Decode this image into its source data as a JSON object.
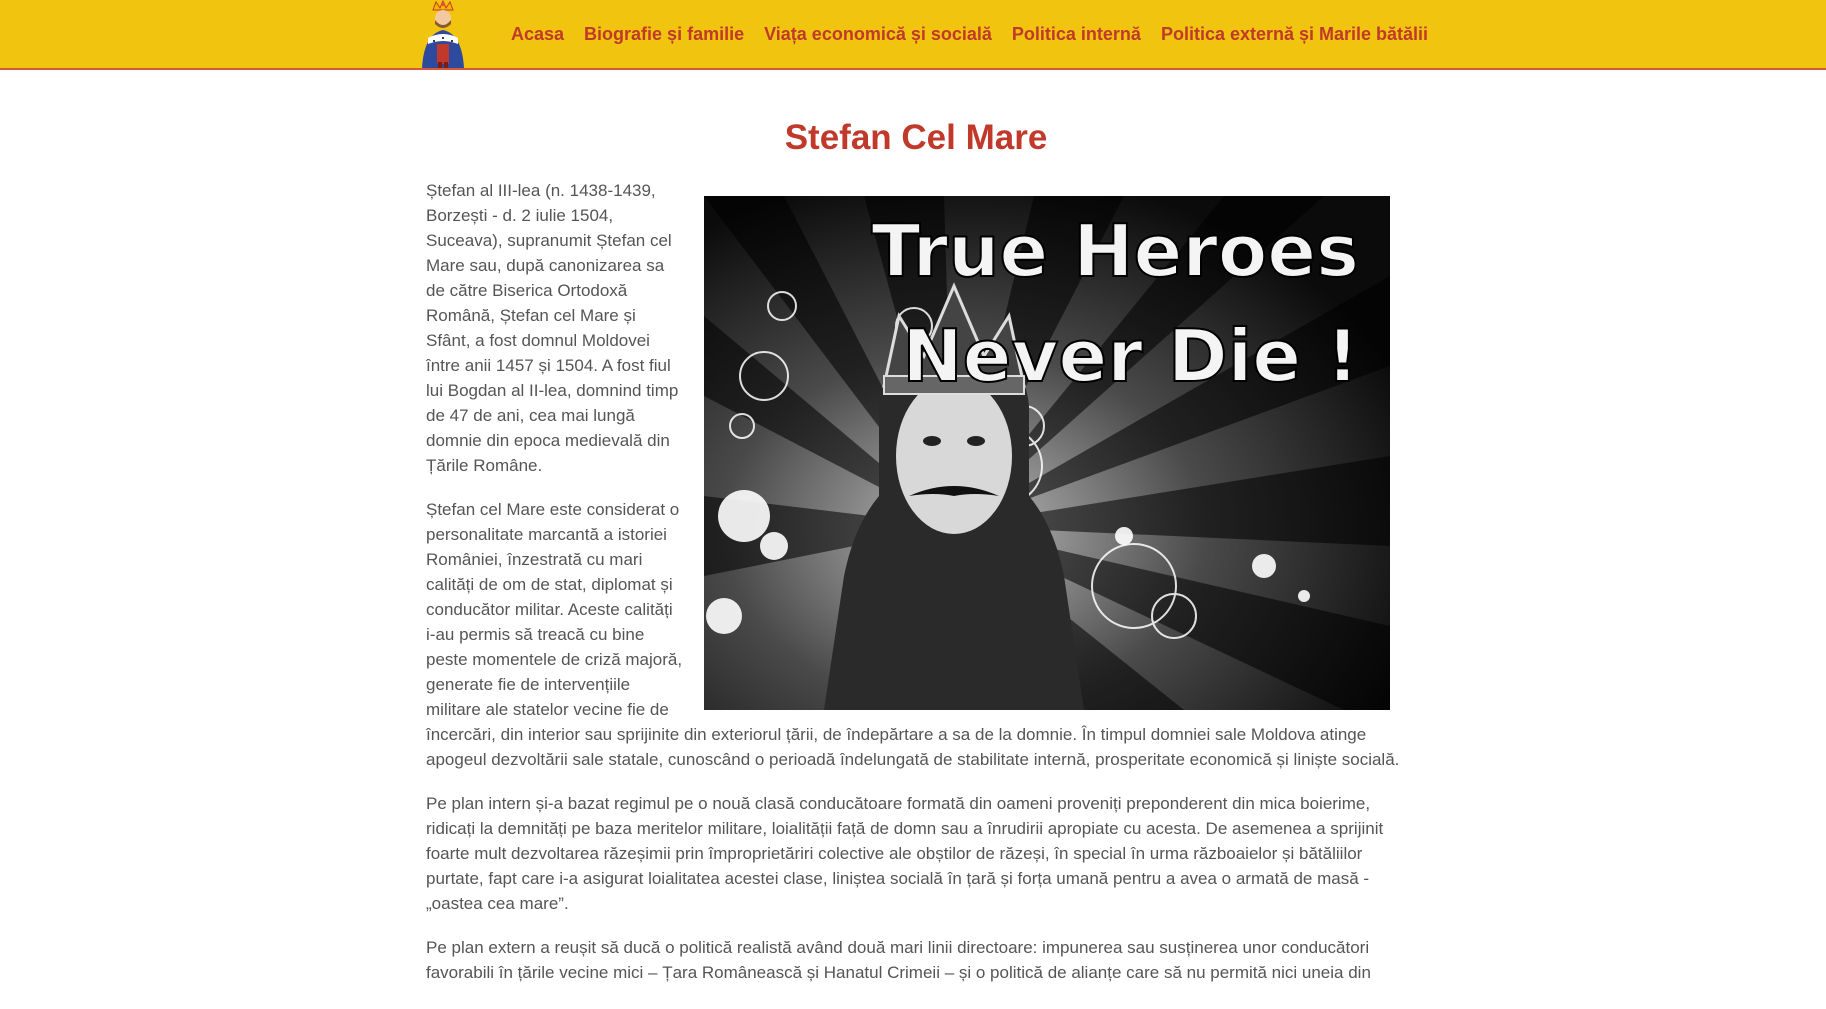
{
  "nav": {
    "links": [
      "Acasa",
      "Biografie și familie",
      "Viața economică și socială",
      "Politica internă",
      "Politica externă și Marile bătălii"
    ]
  },
  "page": {
    "title": "Stefan Cel Mare"
  },
  "hero_image": {
    "line1": "True Heroes",
    "line2": "Never Die !"
  },
  "article": {
    "paragraphs": [
      "Ștefan al III-lea (n. 1438-1439, Borzești - d. 2 iulie 1504, Suceava), supranumit Ștefan cel Mare sau, după canonizarea sa de către Biserica Ortodoxă Română, Ștefan cel Mare și Sfânt, a fost domnul Moldovei între anii 1457 și 1504. A fost fiul lui Bogdan al II-lea, domnind timp de 47 de ani, cea mai lungă domnie din epoca medievală din Țările Române.",
      "Ștefan cel Mare este considerat o personalitate marcantă a istoriei României, înzestrată cu mari calități de om de stat, diplomat și conducător militar. Aceste calități i-au permis să treacă cu bine peste momentele de criză majoră, generate fie de intervențiile militare ale statelor vecine fie de încercări, din interior sau sprijinite din exteriorul țării, de îndepărtare a sa de la domnie. În timpul domniei sale Moldova atinge apogeul dezvoltării sale statale, cunoscând o perioadă îndelungată de stabilitate internă, prosperitate economică și liniște socială.",
      "Pe plan intern și-a bazat regimul pe o nouă clasă conducătoare formată din oameni proveniți preponderent din mica boierime, ridicați la demnități pe baza meritelor militare, loialității față de domn sau a înrudirii apropiate cu acesta. De asemenea a sprijinit foarte mult dezvoltarea răzeșimii prin împroprietăriri colective ale obștilor de răzeși, în special în urma războaielor și bătăliilor purtate, fapt care i-a asigurat loialitatea acestei clase, liniștea socială în țară și forța umană pentru a avea o armată de masă -„oastea cea mare”.",
      "Pe plan extern a reușit să ducă o politică realistă având două mari linii directoare: impunerea sau susținerea unor conducători favorabili în țările vecine mici – Țara Românească și Hanatul Crimeii – și o politică de alianțe care să nu permită nici uneia din"
    ]
  }
}
